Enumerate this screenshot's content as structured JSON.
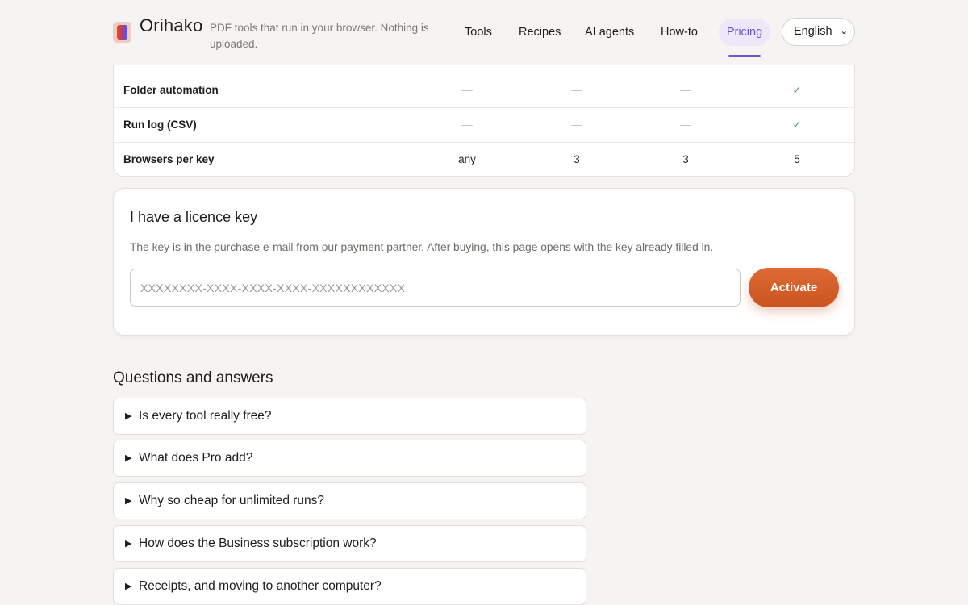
{
  "header": {
    "brand_name": "Orihako",
    "tagline": "PDF tools that run in your browser. Nothing is uploaded.",
    "nav": {
      "tools": "Tools",
      "recipes": "Recipes",
      "ai_agents": "AI agents",
      "how_to": "How-to",
      "pricing": "Pricing"
    },
    "active_nav": "Pricing",
    "language": "English"
  },
  "compare_table": {
    "rows": [
      {
        "label": "Folder automation",
        "values": [
          "—",
          "—",
          "—",
          "✓"
        ]
      },
      {
        "label": "Run log (CSV)",
        "values": [
          "—",
          "—",
          "—",
          "✓"
        ]
      },
      {
        "label": "Browsers per key",
        "values": [
          "any",
          "3",
          "3",
          "5"
        ]
      }
    ]
  },
  "licence": {
    "title": "I have a licence key",
    "description": "The key is in the purchase e-mail from our payment partner. After buying, this page opens with the key already filled in.",
    "input_value": "",
    "input_placeholder": "XXXXXXXX-XXXX-XXXX-XXXX-XXXXXXXXXXXX",
    "button_label": "Activate"
  },
  "faq": {
    "heading": "Questions and answers",
    "items": [
      {
        "question": "Is every tool really free?"
      },
      {
        "question": "What does Pro add?"
      },
      {
        "question": "Why so cheap for unlimited runs?"
      },
      {
        "question": "How does the Business subscription work?"
      },
      {
        "question": "Receipts, and moving to another computer?"
      }
    ]
  },
  "colors": {
    "page_bg": "#f6f4f2",
    "accent_purple": "#6a55d2",
    "activate_orange": "#d65f2a",
    "check_green": "#3a9a62"
  },
  "icons": {
    "logo": "orihako-logo-icon",
    "dropdown": "chevron-down-icon",
    "faq_toggle": "caret-right-icon",
    "included": "check-icon",
    "not_included": "dash-icon"
  }
}
